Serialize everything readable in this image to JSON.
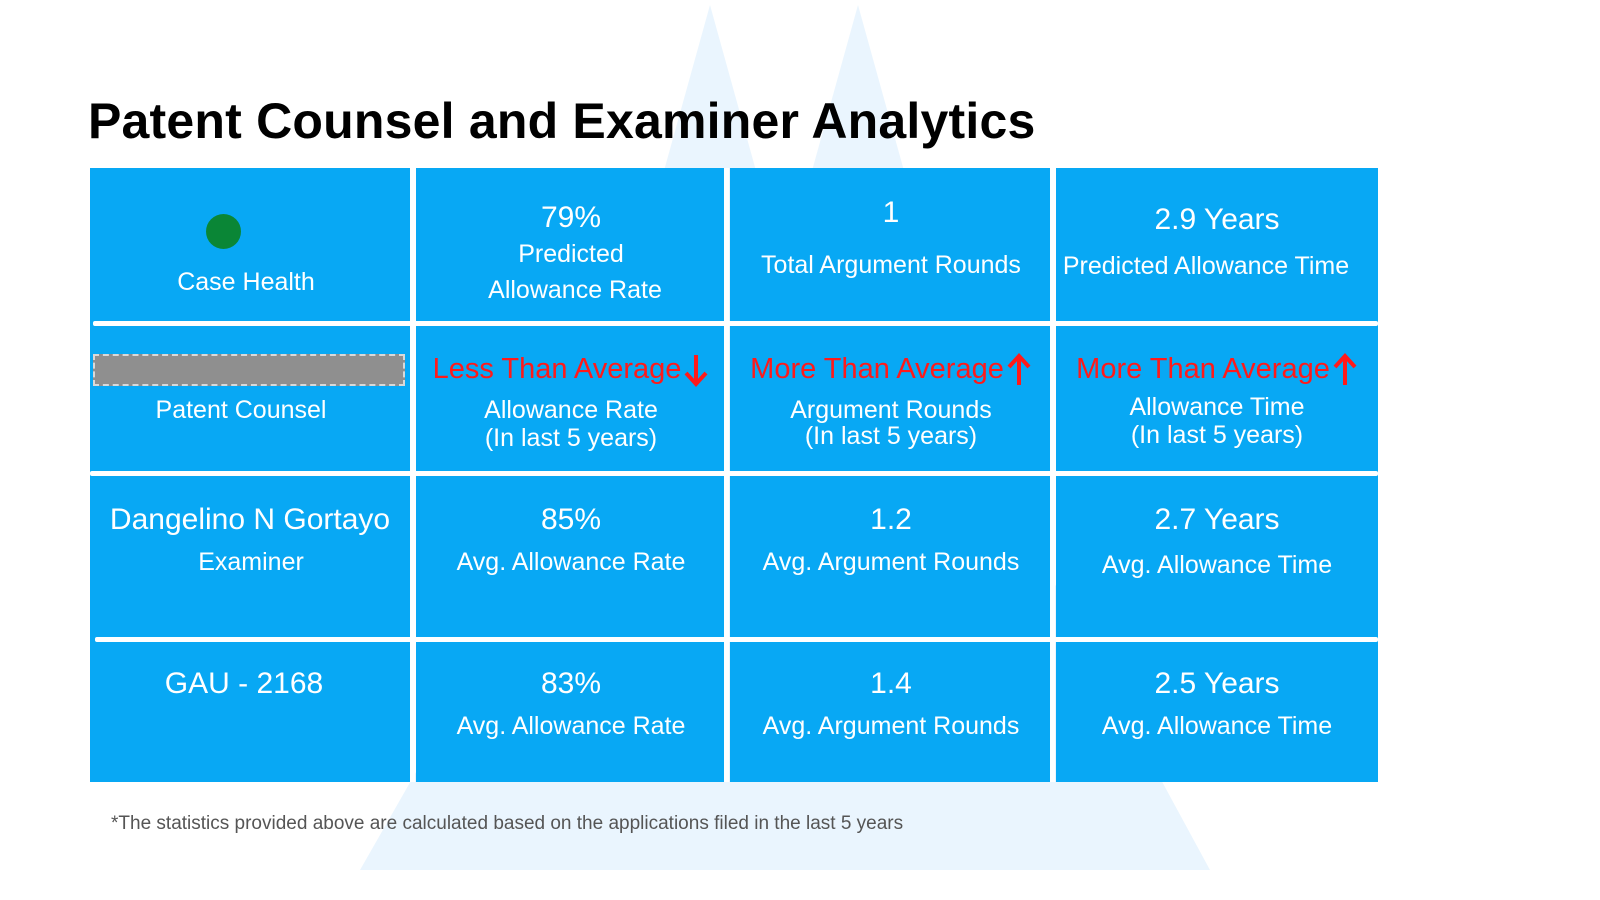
{
  "title": "Patent Counsel and Examiner Analytics",
  "colors": {
    "cell_bg": "#08a8f4",
    "health_indicator": "#0a8636",
    "alert_red": "#ff1a1a",
    "divider": "#ffffff"
  },
  "row_case": {
    "health": {
      "status": "green",
      "label": "Case Health"
    },
    "allowance_rate": {
      "value": "79%",
      "label_line1": "Predicted",
      "label_line2": "Allowance Rate"
    },
    "argument_rounds": {
      "value": "1",
      "label": "Total Argument Rounds"
    },
    "allowance_time": {
      "value": "2.9 Years",
      "label": "Predicted Allowance Time"
    }
  },
  "row_counsel": {
    "name_redacted": true,
    "label": "Patent Counsel",
    "allowance_rate": {
      "comparison": "Less Than Average",
      "direction": "down",
      "label_line1": "Allowance Rate",
      "label_line2": "(In last 5 years)"
    },
    "argument_rounds": {
      "comparison": "More Than Average",
      "direction": "up",
      "label_line1": "Argument Rounds",
      "label_line2": "(In last 5 years)"
    },
    "allowance_time": {
      "comparison": "More Than Average",
      "direction": "up",
      "label_line1": "Allowance Time",
      "label_line2": "(In last 5 years)"
    }
  },
  "row_examiner": {
    "name": "Dangelino N Gortayo",
    "role": "Examiner",
    "allowance_rate": {
      "value": "85%",
      "label": "Avg. Allowance Rate"
    },
    "argument_rounds": {
      "value": "1.2",
      "label": "Avg. Argument Rounds"
    },
    "allowance_time": {
      "value": "2.7 Years",
      "label": "Avg. Allowance Time"
    }
  },
  "row_gau": {
    "name": "GAU - 2168",
    "allowance_rate": {
      "value": "83%",
      "label": "Avg. Allowance Rate"
    },
    "argument_rounds": {
      "value": "1.4",
      "label": "Avg. Argument Rounds"
    },
    "allowance_time": {
      "value": "2.5 Years",
      "label": "Avg. Allowance Time"
    }
  },
  "footnote": "*The statistics provided above are calculated based on the applications filed in the last 5 years"
}
